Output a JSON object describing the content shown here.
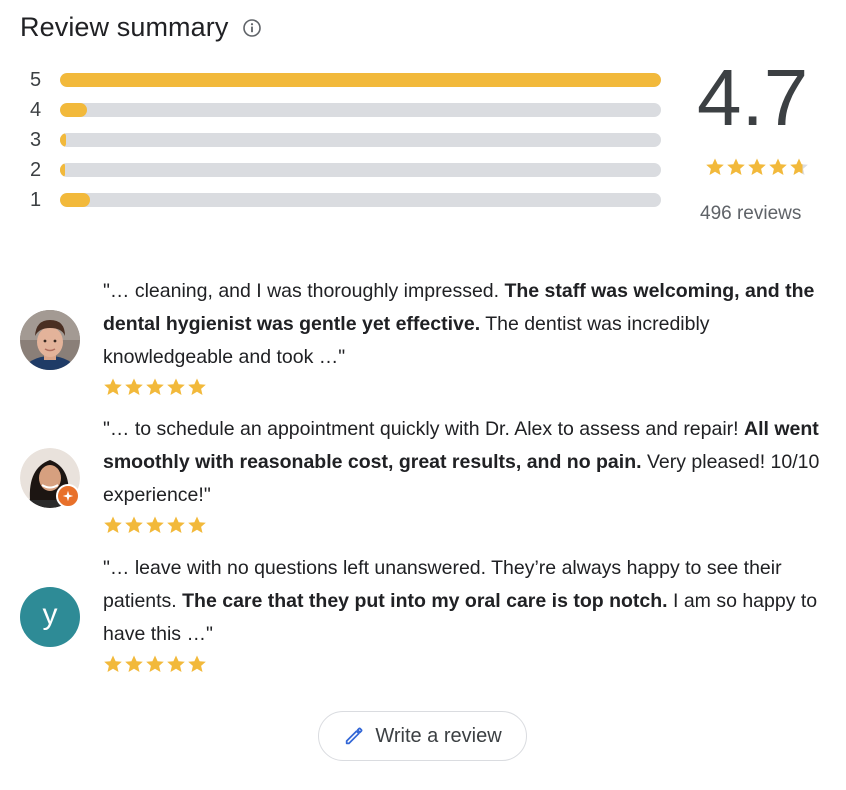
{
  "header": {
    "title": "Review summary",
    "info_icon": "info-icon"
  },
  "rating_breakdown": [
    {
      "label": "5",
      "fraction": 1.0
    },
    {
      "label": "4",
      "fraction": 0.045
    },
    {
      "label": "3",
      "fraction": 0.01
    },
    {
      "label": "2",
      "fraction": 0.008
    },
    {
      "label": "1",
      "fraction": 0.05
    }
  ],
  "summary": {
    "score": "4.7",
    "stars_value": 4.7,
    "review_count": "496 reviews",
    "star_color": "#f2b93b",
    "track_color": "#dadce0"
  },
  "reviews": [
    {
      "parts": [
        {
          "text": "\"… cleaning, and I was thoroughly impressed. ",
          "bold": false
        },
        {
          "text": "The staff was welcoming, and the dental hygienist was gentle yet effective.",
          "bold": true
        },
        {
          "text": " The dentist was incredibly knowledgeable and took …\"",
          "bold": false
        }
      ],
      "stars": 5,
      "avatar": "photo-avatar-young-man"
    },
    {
      "parts": [
        {
          "text": "\"… to schedule an appointment quickly with Dr. Alex to assess and repair! ",
          "bold": false
        },
        {
          "text": "All went smoothly with reasonable cost, great results, and no pain.",
          "bold": true
        },
        {
          "text": " Very pleased! 10/10 experience!\"",
          "bold": false
        }
      ],
      "stars": 5,
      "avatar": "photo-avatar-woman-local-guide"
    },
    {
      "parts": [
        {
          "text": "\"… leave with no questions left unanswered. They’re always happy to see their patients. ",
          "bold": false
        },
        {
          "text": "The care that they put into my oral care is top notch.",
          "bold": true
        },
        {
          "text": " I am so happy to have this …\"",
          "bold": false
        }
      ],
      "stars": 5,
      "avatar": "letter-avatar",
      "avatar_letter": "y",
      "avatar_color": "#2e8b96"
    }
  ],
  "write_review": {
    "label": "Write a review",
    "icon": "pencil-icon"
  }
}
